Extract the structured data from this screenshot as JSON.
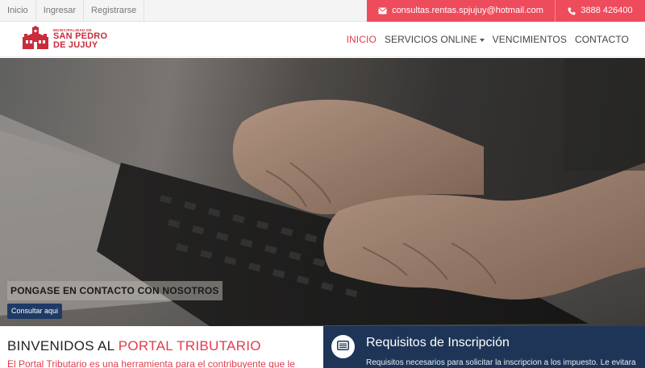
{
  "topbar": {
    "links": [
      "Inicio",
      "Ingresar",
      "Registrarse"
    ],
    "email": "consultas.rentas.spjujuy@hotmail.com",
    "phone": "3888 426400",
    "accent_color": "#ee4b5c"
  },
  "logo": {
    "line1": "MUNICIPALIDAD DE",
    "line2": "SAN PEDRO",
    "line3": "DE JUJUY"
  },
  "nav": {
    "items": [
      "INICIO",
      "SERVICIOS ONLINE",
      "VENCIMIENTOS",
      "CONTACTO"
    ],
    "active_color": "#e23c4c"
  },
  "hero": {
    "heading": "PONGASE EN CONTACTO CON NOSOTROS",
    "button": "Consultar aqui"
  },
  "welcome": {
    "title_prefix": "BINVENIDOS AL ",
    "title_highlight": "PORTAL TRIBUTARIO",
    "text": "El Portal Tributario es una herramienta para el contribuyente que le"
  },
  "requisitos": {
    "title": "Requisitos de Inscripción",
    "text": "Requisitos necesarios para solicitar la inscripcion a los impuesto. Le evitara",
    "bg_color": "#1e3557"
  }
}
